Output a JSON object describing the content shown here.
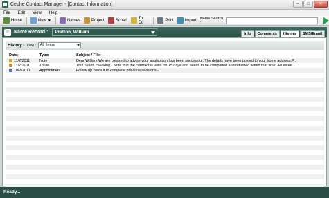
{
  "window": {
    "title": "Cephe Contact Manager - [Contact Information]"
  },
  "menu": [
    "File",
    "Edit",
    "View",
    "Help"
  ],
  "toolbar": {
    "home": "Home",
    "new": "New",
    "names": "Names",
    "project": "Project",
    "sched": "Sched",
    "todo": "To Do",
    "print": "Print",
    "import": "Import",
    "name_search_label": "Name Search :",
    "name_search_value": ""
  },
  "record": {
    "label": "Name Record :",
    "selected": "Pratton, William"
  },
  "tabs": [
    "Info",
    "Comments",
    "History",
    "SMS/Email"
  ],
  "active_tab": "History",
  "history": {
    "title": "History -",
    "view_label": "View :",
    "view_value": "All Items",
    "columns": {
      "date": "Date:",
      "type": "Type:",
      "subject": "Subject / File:"
    },
    "rows": [
      {
        "date": "11/2/2011",
        "type": "Note",
        "subject": "Dear William,We are pleased to advise your application has been successful. The details have been posted to your home address.P...",
        "icon_color": "#d9a42a"
      },
      {
        "date": "11/2/2011",
        "type": "To Do",
        "subject": "This needs checking - Note that the contract is valid for 15 days and needs to be completed and returned within that time. An exten...",
        "icon_color": "#c98b2d"
      },
      {
        "date": "10/2/2011",
        "type": "Appointment",
        "subject": "Follow up consult to complete previous revisions -",
        "icon_color": "#4f6fa8"
      }
    ]
  },
  "status": {
    "text": "Ready..."
  },
  "colors": {
    "brand": "#2a4f47",
    "row_alt": "#eef1f0",
    "go": "#1aa54b"
  }
}
